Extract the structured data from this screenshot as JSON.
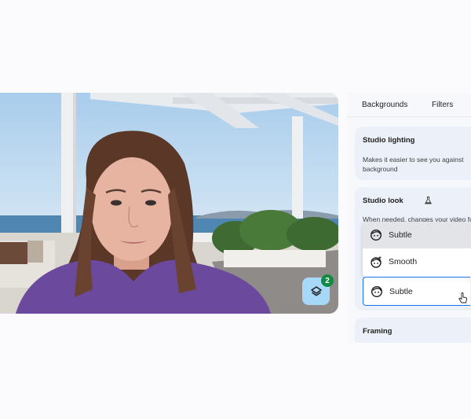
{
  "panel": {
    "tabs": [
      "Backgrounds",
      "Filters"
    ],
    "studio_lighting": {
      "title": "Studio lighting",
      "description": "Makes it easier to see you against background"
    },
    "studio_look": {
      "title": "Studio look",
      "description_peek": "When needed, changes your video for",
      "options": [
        "Subtle",
        "Smooth"
      ],
      "selected": "Subtle"
    },
    "framing": {
      "title": "Framing"
    }
  },
  "video": {
    "effects_badge_count": "2",
    "effects_button_color": "#a8d8f7",
    "badge_color": "#138a44"
  },
  "accent_color": "#1a73e8"
}
